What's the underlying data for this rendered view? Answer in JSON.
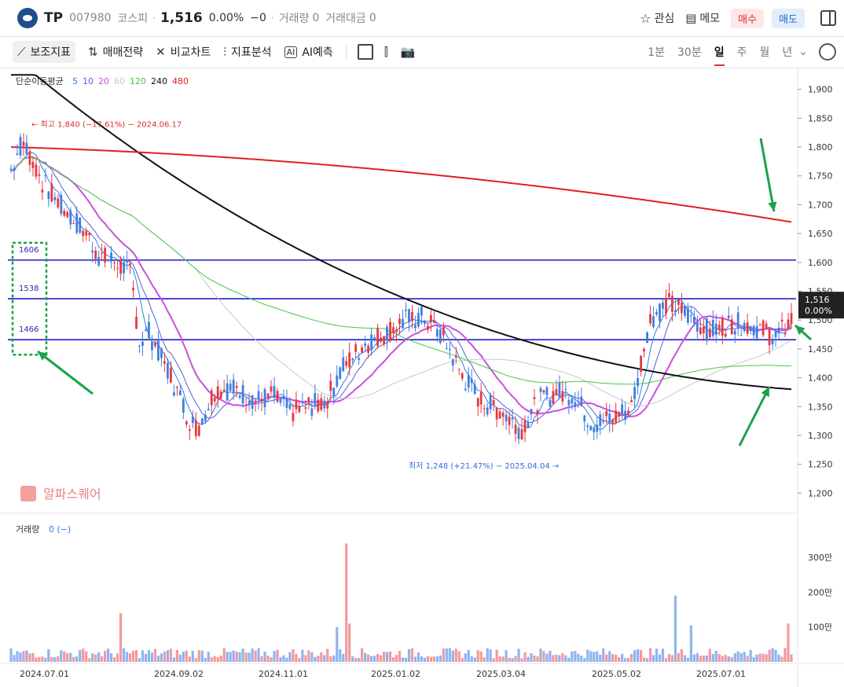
{
  "header": {
    "ticker": "TP",
    "code": "007980",
    "market": "코스피",
    "price": "1,516",
    "change_pct": "0.00%",
    "change_abs": "−0",
    "volume_label": "거래량",
    "volume_value": "0",
    "amount_label": "거래대금",
    "amount_value": "0",
    "watch_label": "관심",
    "memo_label": "메모",
    "buy_label": "매수",
    "sell_label": "매도"
  },
  "toolbar": {
    "items": [
      "보조지표",
      "매매전략",
      "비교차트",
      "지표분석",
      "AI예측"
    ],
    "periods": [
      "1분",
      "30분",
      "일",
      "주",
      "월",
      "년"
    ],
    "selected_period": "일"
  },
  "chart_data": {
    "type": "candlestick",
    "ma_legend_label": "단순이동평균",
    "ma_periods": [
      {
        "period": "5",
        "color": "#2f7de1"
      },
      {
        "period": "10",
        "color": "#5b5bd6"
      },
      {
        "period": "20",
        "color": "#c94fe0"
      },
      {
        "period": "60",
        "color": "#c8c8c8"
      },
      {
        "period": "120",
        "color": "#44c744"
      },
      {
        "period": "240",
        "color": "#111111"
      },
      {
        "period": "480",
        "color": "#e12020"
      }
    ],
    "y_ticks": [
      "1,900",
      "1,850",
      "1,800",
      "1,750",
      "1,700",
      "1,650",
      "1,600",
      "1,550",
      "1,500",
      "1,450",
      "1,400",
      "1,350",
      "1,300",
      "1,250",
      "1,200"
    ],
    "y_range": [
      1180,
      1920
    ],
    "x_ticks": [
      "2024.07.01",
      "2024.09.02",
      "2024.11.01",
      "2025.01.02",
      "2025.03.04",
      "2025.05.02",
      "2025.07.01"
    ],
    "horizontal_lines": [
      {
        "label": "1606",
        "value": 1604
      },
      {
        "label": "1538",
        "value": 1537
      },
      {
        "label": "1466",
        "value": 1466
      }
    ],
    "high_annotation": "최고 1,840 (−17.61%) − 2024.06.17",
    "low_annotation": "최저 1,248 (+21.47%) − 2025.04.04",
    "last_price_tag": {
      "price": "1,516",
      "pct": "0.00%"
    },
    "watermark": "알파스퀘어",
    "volume_panel_label": "거래량",
    "volume_panel_value": "0 (−)",
    "volume_ticks": [
      "300만",
      "200만",
      "100만"
    ],
    "colors": {
      "up": "#e6393f",
      "down": "#3f7ee0",
      "annotation_arrow": "#1aa34a",
      "level_line": "#1f1fcf"
    }
  }
}
